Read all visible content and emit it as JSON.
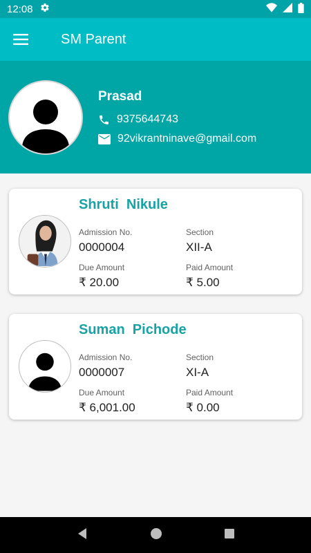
{
  "status_bar": {
    "time": "12:08"
  },
  "app_bar": {
    "title": "SM Parent"
  },
  "profile": {
    "name": "Prasad",
    "phone": "9375644743",
    "email": "92vikrantninave@gmail.com"
  },
  "labels": {
    "admission": "Admission No.",
    "section": "Section",
    "due": "Due Amount",
    "paid": "Paid Amount"
  },
  "students": [
    {
      "name": "Shruti  Nikule",
      "admission_no": "0000004",
      "section": "XII-A",
      "due_amount": "₹ 20.00",
      "paid_amount": "₹ 5.00"
    },
    {
      "name": "Suman  Pichode",
      "admission_no": "0000007",
      "section": "XI-A",
      "due_amount": "₹ 6,001.00",
      "paid_amount": "₹ 0.00"
    }
  ],
  "colors": {
    "status_bar": "#00a3a8",
    "app_bar": "#00bcc4",
    "profile_bg": "#00a5a6",
    "student_name": "#17a2a6"
  }
}
